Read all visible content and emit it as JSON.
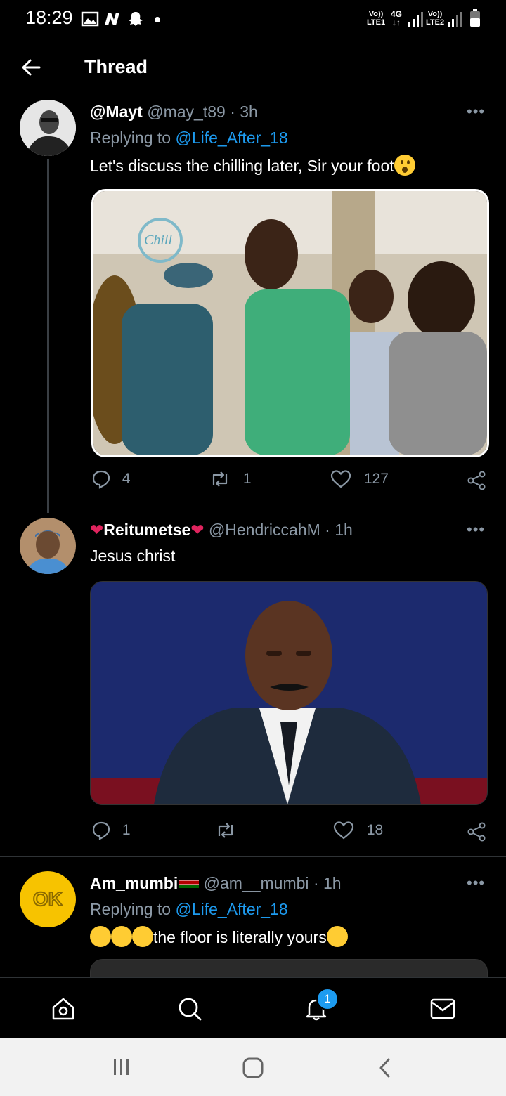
{
  "status_bar": {
    "time": "18:29",
    "left_icons": [
      "image-icon",
      "n-app-icon",
      "snapchat-icon",
      "dot-icon"
    ],
    "sim1_label_top": "Vo))",
    "sim1_label_bottom": "LTE1",
    "network": "4G",
    "sim2_label_top": "Vo))",
    "sim2_label_bottom": "LTE2"
  },
  "header": {
    "back_icon": "arrow-left-icon",
    "title": "Thread"
  },
  "tweets": [
    {
      "name": "@Mayt",
      "handle": "@may_t89",
      "sep": "·",
      "time": "3h",
      "replying_prefix": "Replying to",
      "replying_to": "@Life_After_18",
      "text": "Let's discuss the chilling later, Sir your foot",
      "text_emoji": "astonished-face",
      "media_alt": "photo of people dancing at an event",
      "media_sign": "Chill",
      "replies": "4",
      "retweets": "1",
      "likes": "127"
    },
    {
      "name": "Reitumetse",
      "name_emoji": "red-heart",
      "handle": "@HendriccahM",
      "sep": "·",
      "time": "1h",
      "text": "Jesus christ",
      "media_alt": "man in suit with surprised face",
      "replies": "1",
      "retweets": "",
      "likes": "18"
    },
    {
      "name": "Am_mumbi",
      "name_emoji": "kenya-flag",
      "handle": "@am__mumbi",
      "sep": "·",
      "time": "1h",
      "replying_prefix": "Replying to",
      "replying_to": "@Life_After_18",
      "text": "the floor is literally yours",
      "text_emoji_prefix": "rolling-on-floor-laughing x3",
      "text_emoji_suffix": "grinning-sweat",
      "avatar_text": "OK"
    }
  ],
  "more_label": "•••",
  "bottom_nav": {
    "items": [
      "home-icon",
      "search-icon",
      "notifications-icon",
      "messages-icon"
    ],
    "notification_badge": "1"
  },
  "colors": {
    "background": "#000000",
    "link": "#1d9bf0",
    "muted": "#8b98a5",
    "heart": "#e0245e"
  }
}
